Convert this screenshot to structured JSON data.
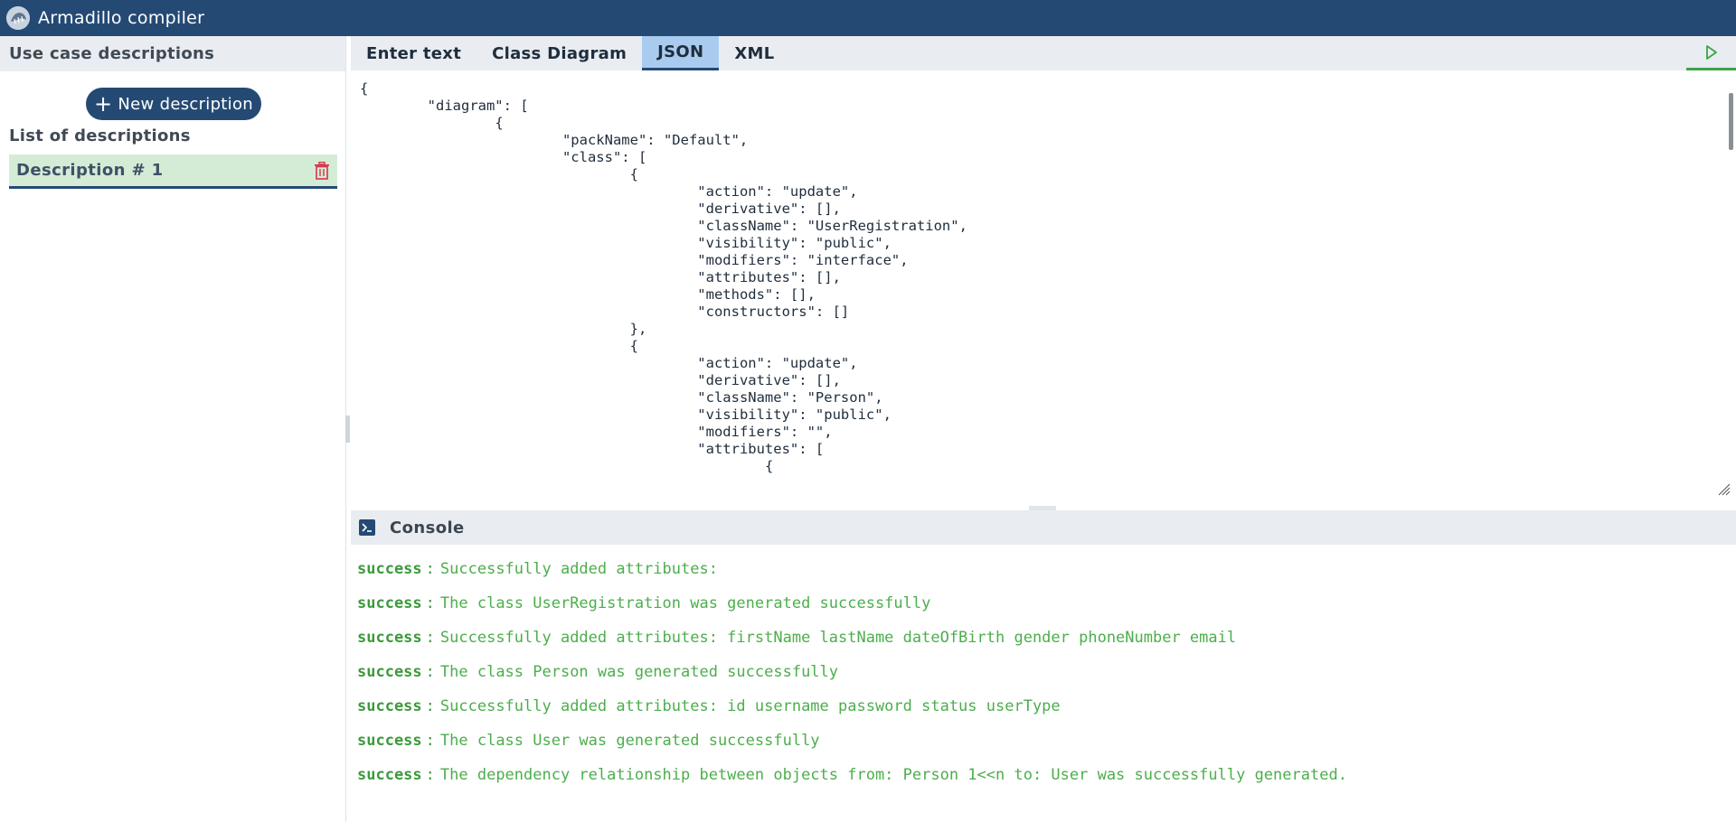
{
  "app": {
    "title": "Armadillo compiler"
  },
  "sidebar": {
    "header": "Use case descriptions",
    "new_button": "New description",
    "list_title": "List of descriptions",
    "items": [
      {
        "label": "Description # 1"
      }
    ]
  },
  "tabs": [
    {
      "label": "Enter text"
    },
    {
      "label": "Class Diagram"
    },
    {
      "label": "JSON",
      "active": true
    },
    {
      "label": "XML"
    }
  ],
  "editor": {
    "content": "{\n\t\"diagram\": [\n\t\t{\n\t\t\t\"packName\": \"Default\",\n\t\t\t\"class\": [\n\t\t\t\t{\n\t\t\t\t\t\"action\": \"update\",\n\t\t\t\t\t\"derivative\": [],\n\t\t\t\t\t\"className\": \"UserRegistration\",\n\t\t\t\t\t\"visibility\": \"public\",\n\t\t\t\t\t\"modifiers\": \"interface\",\n\t\t\t\t\t\"attributes\": [],\n\t\t\t\t\t\"methods\": [],\n\t\t\t\t\t\"constructors\": []\n\t\t\t\t},\n\t\t\t\t{\n\t\t\t\t\t\"action\": \"update\",\n\t\t\t\t\t\"derivative\": [],\n\t\t\t\t\t\"className\": \"Person\",\n\t\t\t\t\t\"visibility\": \"public\",\n\t\t\t\t\t\"modifiers\": \"\",\n\t\t\t\t\t\"attributes\": [\n\t\t\t\t\t\t{"
  },
  "console": {
    "title": "Console",
    "separator": ":",
    "lines": [
      {
        "status": "success",
        "message": "Successfully added attributes:"
      },
      {
        "status": "success",
        "message": "The class UserRegistration was generated successfully"
      },
      {
        "status": "success",
        "message": "Successfully added attributes: firstName lastName dateOfBirth gender phoneNumber email"
      },
      {
        "status": "success",
        "message": "The class Person was generated successfully"
      },
      {
        "status": "success",
        "message": "Successfully added attributes: id username password status userType"
      },
      {
        "status": "success",
        "message": "The class User was generated successfully"
      },
      {
        "status": "success",
        "message": "The dependency relationship between objects from: Person 1<<n to: User was successfully generated."
      }
    ]
  },
  "colors": {
    "header_bg": "#244a74",
    "active_tab": "#a9cbef",
    "selected_item": "#d4ecd6",
    "success": "#4cae4c",
    "delete": "#d9334a",
    "run": "#3aa547"
  },
  "icons": {
    "logo": "armadillo-logo",
    "new": "plus-icon",
    "delete": "trash-icon",
    "run": "play-icon",
    "console": "terminal-icon"
  }
}
